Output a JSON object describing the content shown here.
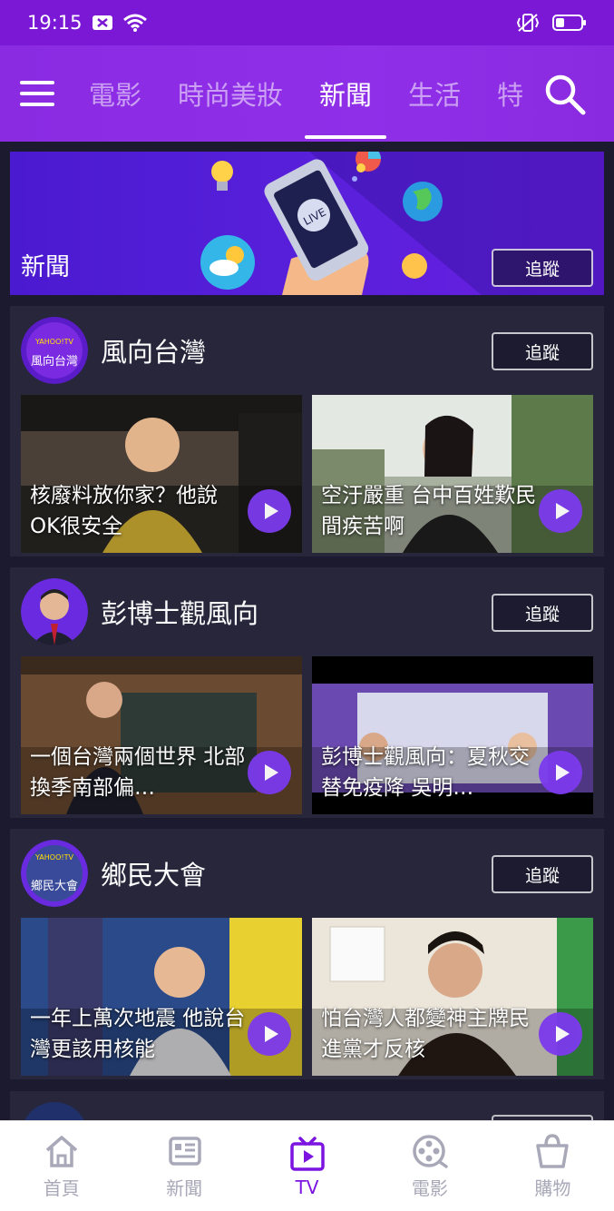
{
  "status": {
    "time": "19:15"
  },
  "nav": {
    "tabs": [
      {
        "label": "電影",
        "active": false
      },
      {
        "label": "時尚美妝",
        "active": false
      },
      {
        "label": "新聞",
        "active": true
      },
      {
        "label": "生活",
        "active": false
      },
      {
        "label": "特",
        "active": false
      }
    ]
  },
  "banner": {
    "title": "新聞",
    "follow_label": "追蹤"
  },
  "channels": [
    {
      "name": "風向台灣",
      "avatar_text": "風向台灣",
      "follow_label": "追蹤",
      "videos": [
        {
          "title": "核廢料放你家？他說OK很安全"
        },
        {
          "title": "空汙嚴重 台中百姓歎民間疾苦啊"
        }
      ]
    },
    {
      "name": "彭博士觀風向",
      "follow_label": "追蹤",
      "videos": [
        {
          "title": "一個台灣兩個世界 北部換季南部偏…"
        },
        {
          "title": "彭博士觀風向：夏秋交替免疫降 吳明…"
        }
      ]
    },
    {
      "name": "鄉民大會",
      "avatar_text": "鄉民大會",
      "follow_label": "追蹤",
      "videos": [
        {
          "title": "一年上萬次地震 他說台灣更該用核能"
        },
        {
          "title": "怕台灣人都變神主牌民進黨才反核"
        }
      ]
    }
  ],
  "bottom_nav": [
    {
      "label": "首頁",
      "icon": "home-icon",
      "active": false
    },
    {
      "label": "新聞",
      "icon": "news-icon",
      "active": false
    },
    {
      "label": "TV",
      "icon": "tv-icon",
      "active": true
    },
    {
      "label": "電影",
      "icon": "film-reel-icon",
      "active": false
    },
    {
      "label": "購物",
      "icon": "shopping-bag-icon",
      "active": false
    }
  ],
  "colors": {
    "accent": "#7b14e0",
    "header": "#8a2be2",
    "background": "#1b1a2e",
    "card": "#27263b"
  }
}
